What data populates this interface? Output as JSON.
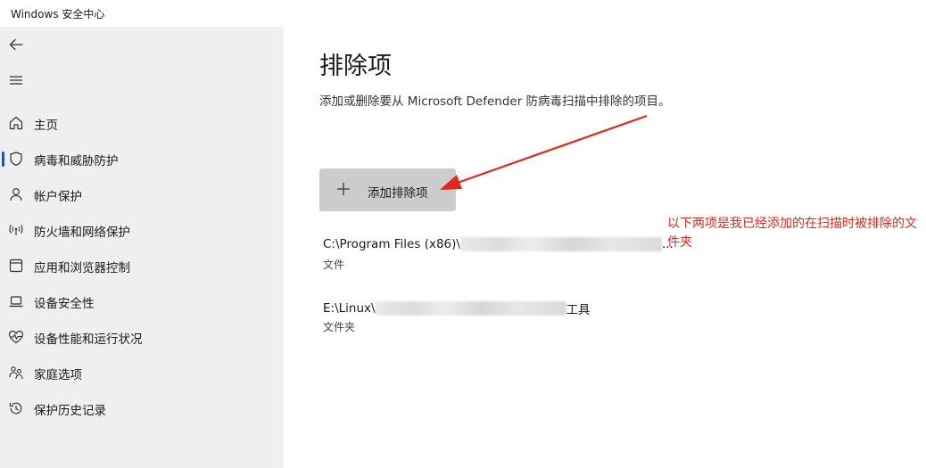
{
  "window": {
    "title": "Windows 安全中心"
  },
  "sidebar": {
    "back_icon": "back-arrow-icon",
    "menu_icon": "hamburger-menu-icon",
    "items": [
      {
        "label": "主页",
        "icon": "home-icon",
        "active": false
      },
      {
        "label": "病毒和威胁防护",
        "icon": "shield-icon",
        "active": true
      },
      {
        "label": "帐户保护",
        "icon": "person-icon",
        "active": false
      },
      {
        "label": "防火墙和网络保护",
        "icon": "wifi-antenna-icon",
        "active": false
      },
      {
        "label": "应用和浏览器控制",
        "icon": "app-window-icon",
        "active": false
      },
      {
        "label": "设备安全性",
        "icon": "laptop-icon",
        "active": false
      },
      {
        "label": "设备性能和运行状况",
        "icon": "heart-pulse-icon",
        "active": false
      },
      {
        "label": "家庭选项",
        "icon": "family-icon",
        "active": false
      },
      {
        "label": "保护历史记录",
        "icon": "history-icon",
        "active": false
      }
    ]
  },
  "main": {
    "title": "排除项",
    "description": "添加或删除要从 Microsoft Defender 防病毒扫描中排除的项目。",
    "add_button_label": "添加排除项",
    "exclusions": [
      {
        "path_prefix": "C:\\Program Files (x86)\\",
        "path_suffix": "...",
        "type": "文件"
      },
      {
        "path_prefix": "E:\\Linux\\",
        "path_suffix": "工具",
        "type": "文件夹"
      }
    ]
  },
  "annotation": {
    "text": "以下两项是我已经添加的在扫描时被排除的文件夹",
    "color": "#e0281a"
  },
  "colors": {
    "sidebar_bg": "#efefef",
    "accent": "#005fb8",
    "button_bg": "#cccccc",
    "annotation": "#e0281a"
  }
}
